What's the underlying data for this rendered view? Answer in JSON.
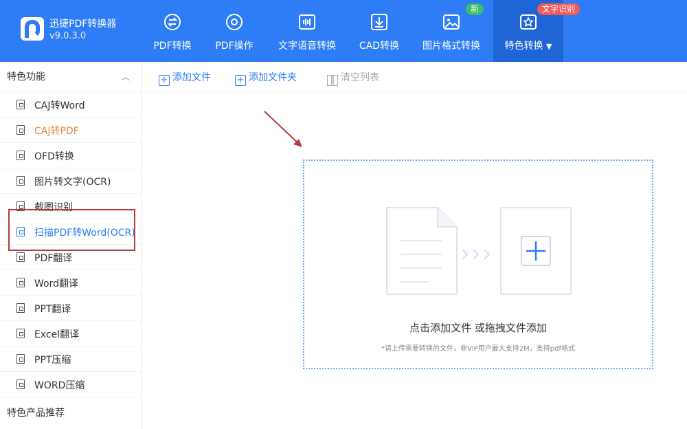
{
  "app": {
    "name": "迅捷PDF转换器",
    "version": "v9.0.3.0"
  },
  "nav": [
    {
      "label": "PDF转换",
      "icon": "pdf-convert-icon"
    },
    {
      "label": "PDF操作",
      "icon": "pdf-operate-icon"
    },
    {
      "label": "文字语音转换",
      "icon": "text-speech-icon"
    },
    {
      "label": "CAD转换",
      "icon": "cad-icon"
    },
    {
      "label": "图片格式转换",
      "icon": "image-format-icon"
    },
    {
      "label": "特色转换",
      "icon": "special-convert-icon",
      "active": true
    }
  ],
  "badges": {
    "new": "新",
    "ocr": "文字识别"
  },
  "sidebar": {
    "heading": "特色功能",
    "items": [
      {
        "label": "CAJ转Word"
      },
      {
        "label": "CAJ转PDF",
        "state": "hover"
      },
      {
        "label": "OFD转换"
      },
      {
        "label": "图片转文字(OCR)"
      },
      {
        "label": "截图识别"
      },
      {
        "label": "扫描PDF转Word(OCR)",
        "state": "selected"
      },
      {
        "label": "PDF翻译"
      },
      {
        "label": "Word翻译"
      },
      {
        "label": "PPT翻译"
      },
      {
        "label": "Excel翻译"
      },
      {
        "label": "PPT压缩"
      },
      {
        "label": "WORD压缩"
      }
    ],
    "footer": "特色产品推荐"
  },
  "toolbar": {
    "add_file": "添加文件",
    "add_folder": "添加文件夹",
    "clear_list": "清空列表"
  },
  "dropzone": {
    "main_text": "点击添加文件 或拖拽文件添加",
    "hint_text": "*请上传需要转换的文件，非VIP用户最大支持2M，支持pdf格式"
  },
  "colors": {
    "header": "#2f7df6",
    "accent": "#2f7df6",
    "hover_text": "#e8883a",
    "annotation": "#b33b3b"
  }
}
